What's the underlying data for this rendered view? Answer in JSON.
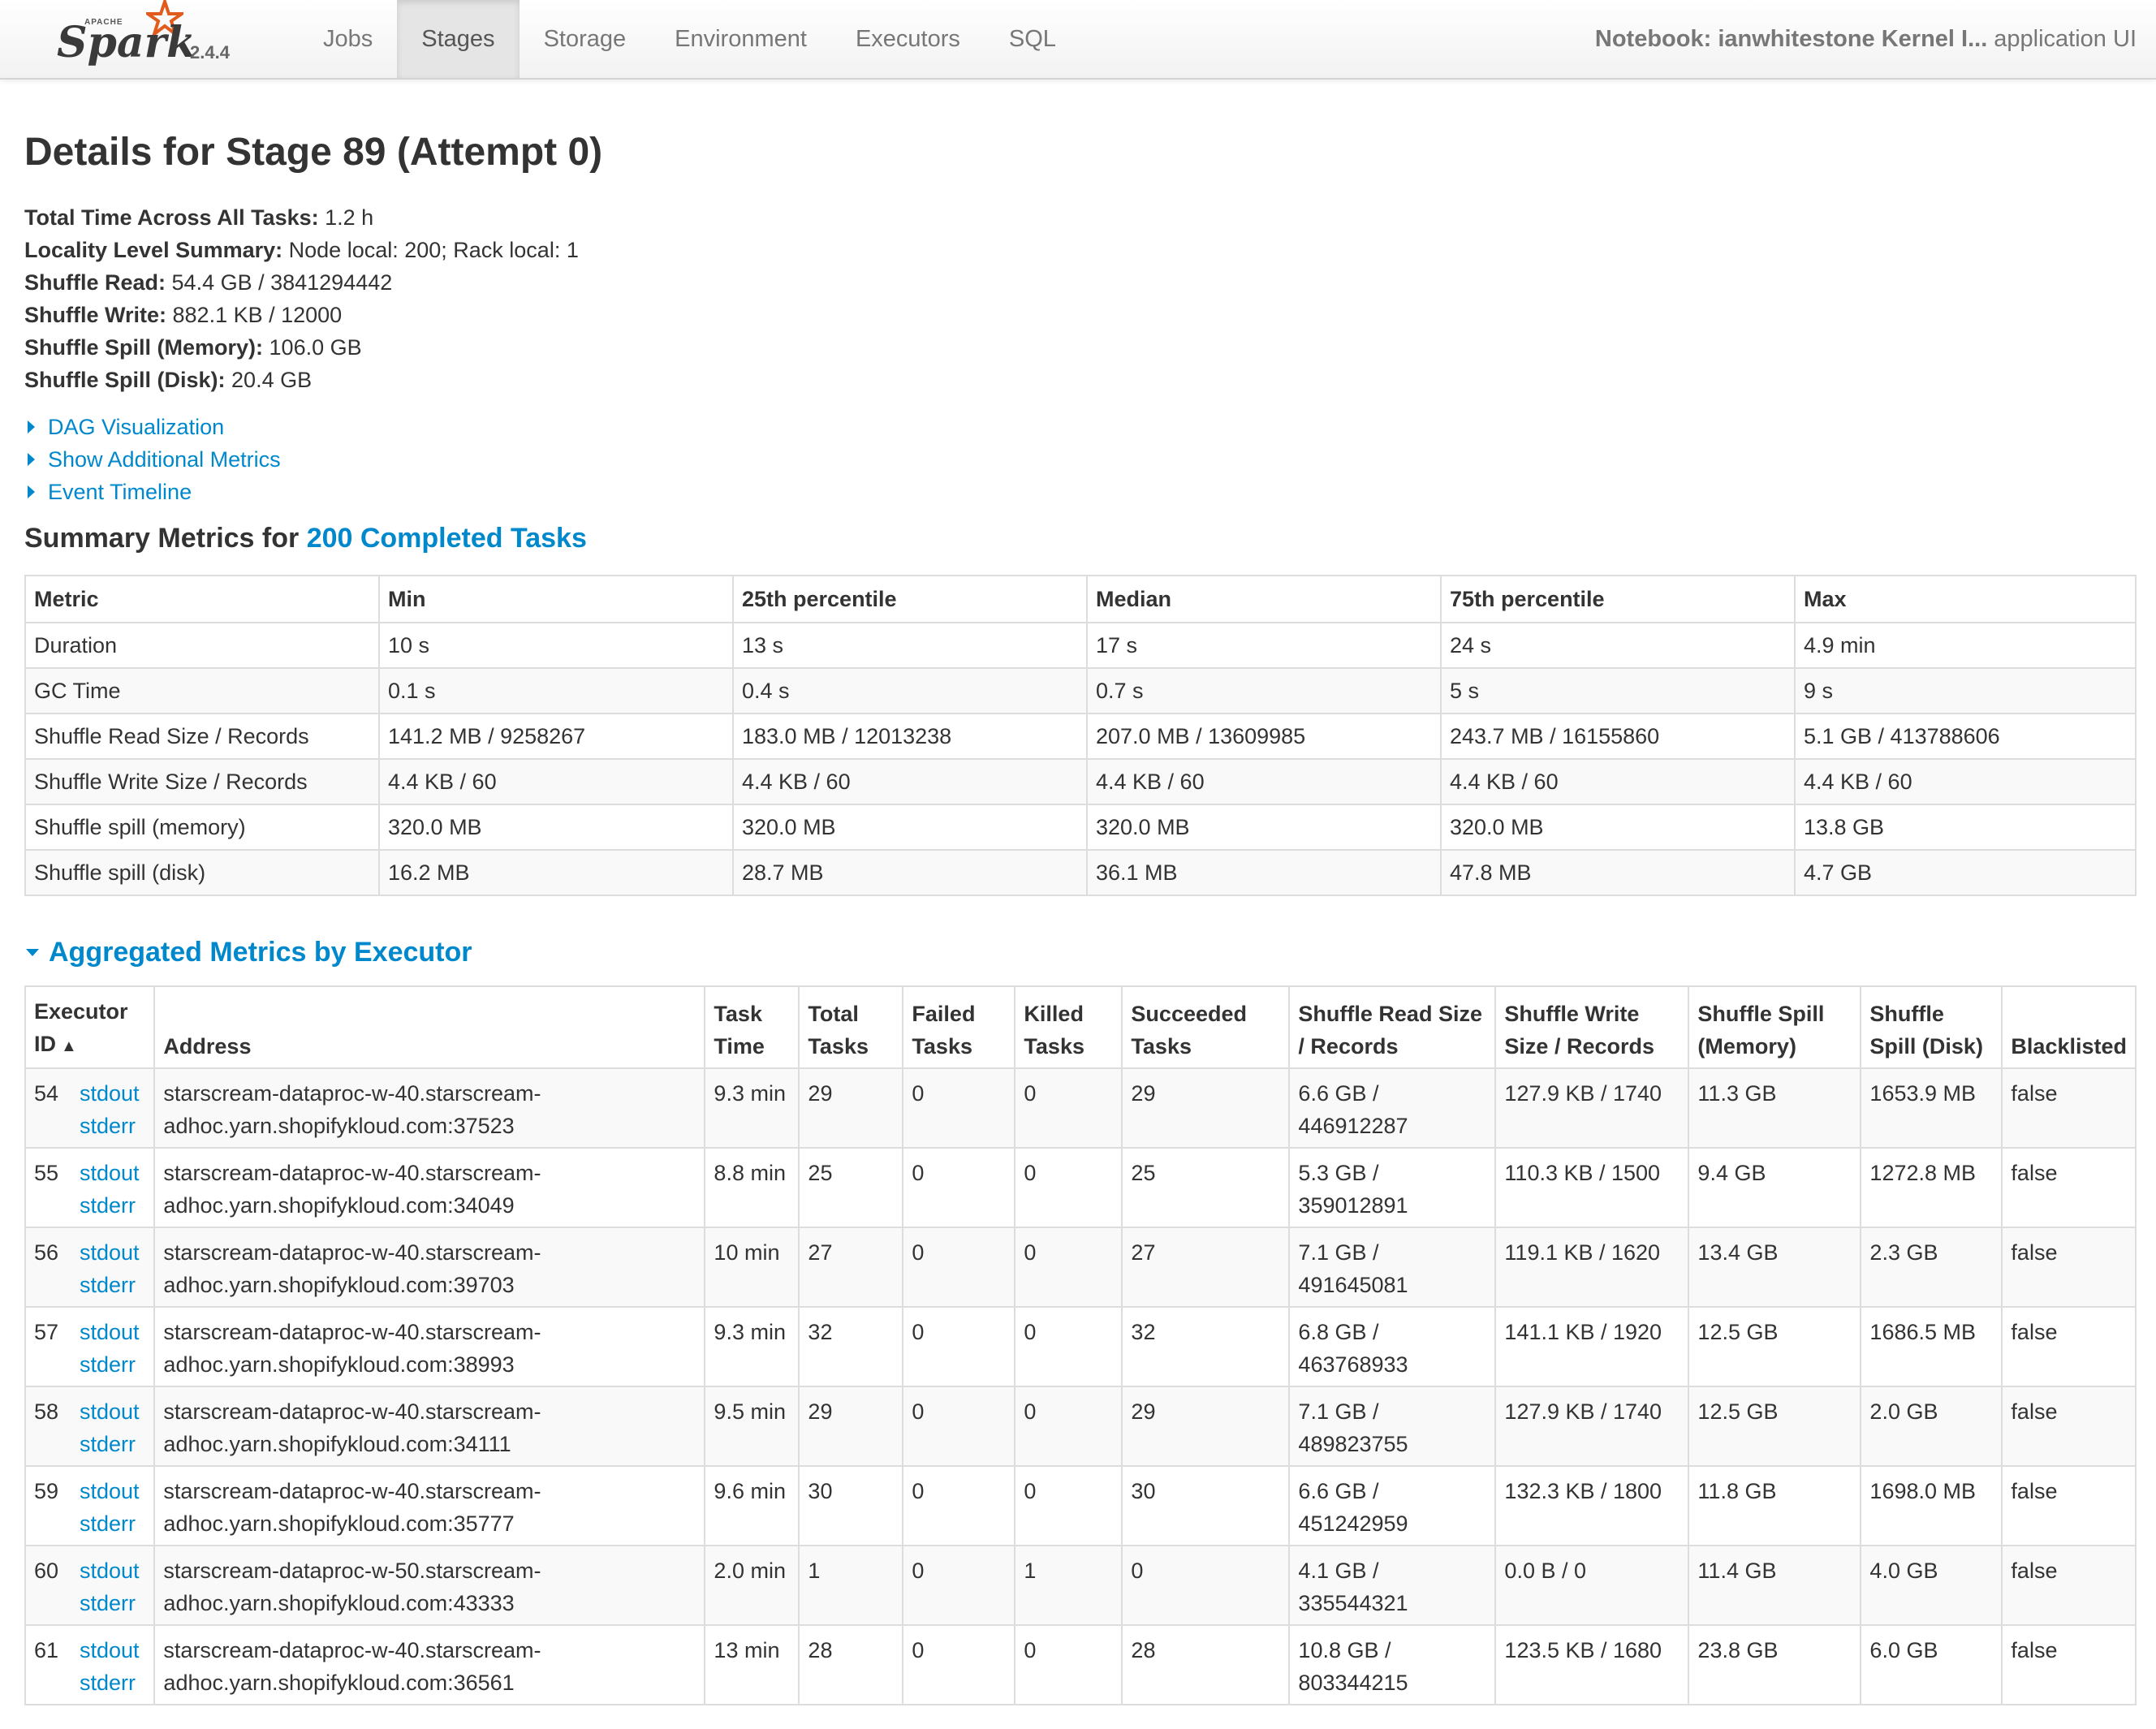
{
  "nav": {
    "brand_apache": "APACHE",
    "brand_name": "Spark",
    "version": "2.4.4",
    "tabs": [
      {
        "label": "Jobs"
      },
      {
        "label": "Stages"
      },
      {
        "label": "Storage"
      },
      {
        "label": "Environment"
      },
      {
        "label": "Executors"
      },
      {
        "label": "SQL"
      }
    ],
    "active_tab": "Stages",
    "app_name": "Notebook: ianwhitestone Kernel I...",
    "app_suffix": "application UI"
  },
  "page": {
    "title": "Details for Stage 89 (Attempt 0)",
    "summary": [
      {
        "label": "Total Time Across All Tasks:",
        "value": "1.2 h"
      },
      {
        "label": "Locality Level Summary:",
        "value": "Node local: 200; Rack local: 1"
      },
      {
        "label": "Shuffle Read:",
        "value": "54.4 GB / 3841294442"
      },
      {
        "label": "Shuffle Write:",
        "value": "882.1 KB / 12000"
      },
      {
        "label": "Shuffle Spill (Memory):",
        "value": "106.0 GB"
      },
      {
        "label": "Shuffle Spill (Disk):",
        "value": "20.4 GB"
      }
    ],
    "toggles": [
      "DAG Visualization",
      "Show Additional Metrics",
      "Event Timeline"
    ]
  },
  "summary_metrics": {
    "heading_prefix": "Summary Metrics for",
    "heading_link": "200 Completed Tasks",
    "columns": [
      "Metric",
      "Min",
      "25th percentile",
      "Median",
      "75th percentile",
      "Max"
    ],
    "rows": [
      [
        "Duration",
        "10 s",
        "13 s",
        "17 s",
        "24 s",
        "4.9 min"
      ],
      [
        "GC Time",
        "0.1 s",
        "0.4 s",
        "0.7 s",
        "5 s",
        "9 s"
      ],
      [
        "Shuffle Read Size / Records",
        "141.2 MB / 9258267",
        "183.0 MB / 12013238",
        "207.0 MB / 13609985",
        "243.7 MB / 16155860",
        "5.1 GB / 413788606"
      ],
      [
        "Shuffle Write Size / Records",
        "4.4 KB / 60",
        "4.4 KB / 60",
        "4.4 KB / 60",
        "4.4 KB / 60",
        "4.4 KB / 60"
      ],
      [
        "Shuffle spill (memory)",
        "320.0 MB",
        "320.0 MB",
        "320.0 MB",
        "320.0 MB",
        "13.8 GB"
      ],
      [
        "Shuffle spill (disk)",
        "16.2 MB",
        "28.7 MB",
        "36.1 MB",
        "47.8 MB",
        "4.7 GB"
      ]
    ]
  },
  "executors": {
    "heading": "Aggregated Metrics by Executor",
    "columns": {
      "executor_id": "Executor ID",
      "sort_indicator": "▲",
      "address": "Address",
      "task_time": "Task Time",
      "total_tasks": "Total Tasks",
      "failed_tasks": "Failed Tasks",
      "killed_tasks": "Killed Tasks",
      "succeeded_tasks": "Succeeded Tasks",
      "shuffle_read": "Shuffle Read Size / Records",
      "shuffle_write": "Shuffle Write Size / Records",
      "spill_memory": "Shuffle Spill (Memory)",
      "spill_disk": "Shuffle Spill (Disk)",
      "blacklisted": "Blacklisted"
    },
    "stdout_label": "stdout",
    "stderr_label": "stderr",
    "rows": [
      {
        "id": "54",
        "addr1": "starscream-dataproc-w-40.starscream-",
        "addr2": "adhoc.yarn.shopifykloud.com:37523",
        "task_time": "9.3 min",
        "total": "29",
        "failed": "0",
        "killed": "0",
        "succeeded": "29",
        "read1": "6.6 GB /",
        "read2": "446912287",
        "write": "127.9 KB / 1740",
        "spill_mem": "11.3 GB",
        "spill_disk": "1653.9 MB",
        "blacklisted": "false"
      },
      {
        "id": "55",
        "addr1": "starscream-dataproc-w-40.starscream-",
        "addr2": "adhoc.yarn.shopifykloud.com:34049",
        "task_time": "8.8 min",
        "total": "25",
        "failed": "0",
        "killed": "0",
        "succeeded": "25",
        "read1": "5.3 GB /",
        "read2": "359012891",
        "write": "110.3 KB / 1500",
        "spill_mem": "9.4 GB",
        "spill_disk": "1272.8 MB",
        "blacklisted": "false"
      },
      {
        "id": "56",
        "addr1": "starscream-dataproc-w-40.starscream-",
        "addr2": "adhoc.yarn.shopifykloud.com:39703",
        "task_time": "10 min",
        "total": "27",
        "failed": "0",
        "killed": "0",
        "succeeded": "27",
        "read1": "7.1 GB /",
        "read2": "491645081",
        "write": "119.1 KB / 1620",
        "spill_mem": "13.4 GB",
        "spill_disk": "2.3 GB",
        "blacklisted": "false"
      },
      {
        "id": "57",
        "addr1": "starscream-dataproc-w-40.starscream-",
        "addr2": "adhoc.yarn.shopifykloud.com:38993",
        "task_time": "9.3 min",
        "total": "32",
        "failed": "0",
        "killed": "0",
        "succeeded": "32",
        "read1": "6.8 GB /",
        "read2": "463768933",
        "write": "141.1 KB / 1920",
        "spill_mem": "12.5 GB",
        "spill_disk": "1686.5 MB",
        "blacklisted": "false"
      },
      {
        "id": "58",
        "addr1": "starscream-dataproc-w-40.starscream-",
        "addr2": "adhoc.yarn.shopifykloud.com:34111",
        "task_time": "9.5 min",
        "total": "29",
        "failed": "0",
        "killed": "0",
        "succeeded": "29",
        "read1": "7.1 GB /",
        "read2": "489823755",
        "write": "127.9 KB / 1740",
        "spill_mem": "12.5 GB",
        "spill_disk": "2.0 GB",
        "blacklisted": "false"
      },
      {
        "id": "59",
        "addr1": "starscream-dataproc-w-40.starscream-",
        "addr2": "adhoc.yarn.shopifykloud.com:35777",
        "task_time": "9.6 min",
        "total": "30",
        "failed": "0",
        "killed": "0",
        "succeeded": "30",
        "read1": "6.6 GB /",
        "read2": "451242959",
        "write": "132.3 KB / 1800",
        "spill_mem": "11.8 GB",
        "spill_disk": "1698.0 MB",
        "blacklisted": "false"
      },
      {
        "id": "60",
        "addr1": "starscream-dataproc-w-50.starscream-",
        "addr2": "adhoc.yarn.shopifykloud.com:43333",
        "task_time": "2.0 min",
        "total": "1",
        "failed": "0",
        "killed": "1",
        "succeeded": "0",
        "read1": "4.1 GB /",
        "read2": "335544321",
        "write": "0.0 B / 0",
        "spill_mem": "11.4 GB",
        "spill_disk": "4.0 GB",
        "blacklisted": "false"
      },
      {
        "id": "61",
        "addr1": "starscream-dataproc-w-40.starscream-",
        "addr2": "adhoc.yarn.shopifykloud.com:36561",
        "task_time": "13 min",
        "total": "28",
        "failed": "0",
        "killed": "0",
        "succeeded": "28",
        "read1": "10.8 GB /",
        "read2": "803344215",
        "write": "123.5 KB / 1680",
        "spill_mem": "23.8 GB",
        "spill_disk": "6.0 GB",
        "blacklisted": "false"
      }
    ]
  }
}
